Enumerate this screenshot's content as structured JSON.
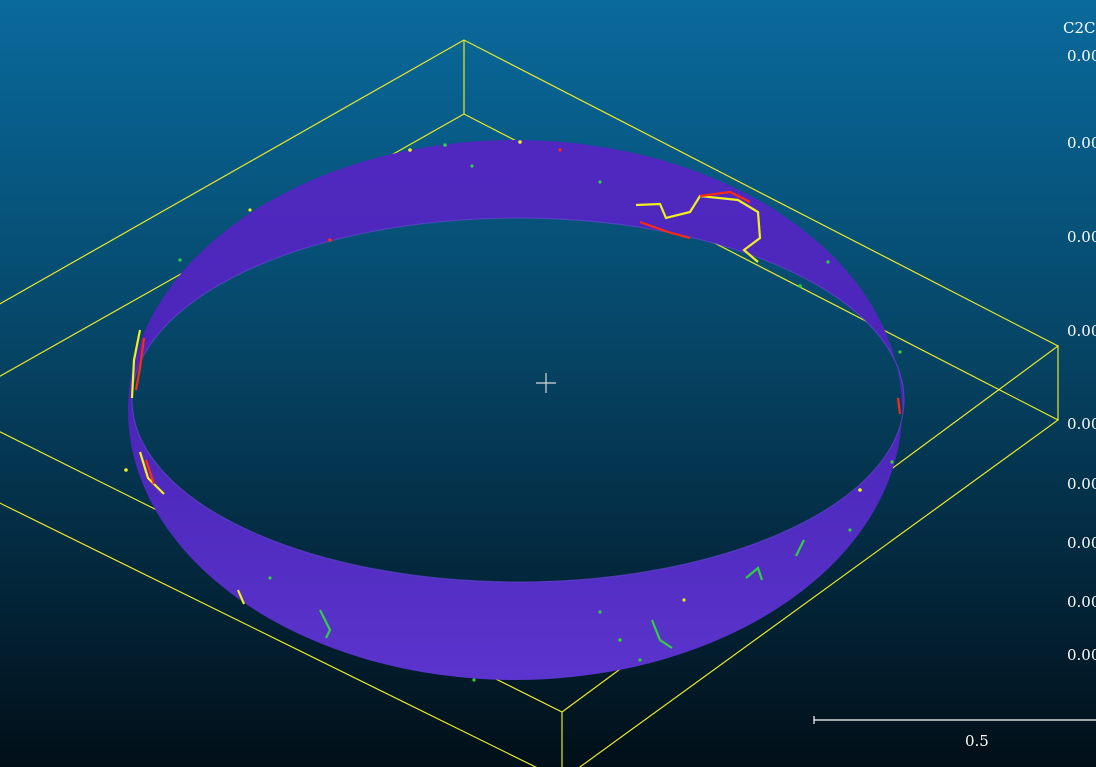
{
  "viewer": {
    "scalar_field_title": "C2C",
    "scale_ticks": [
      "0.00",
      "0.00",
      "0.00",
      "0.00",
      "0.00",
      "0.00",
      "0.00",
      "0.00",
      "0.00"
    ],
    "scale_bar_label": "0.5"
  },
  "colors": {
    "background_top": "#0a6a9c",
    "background_bottom": "#010f18",
    "bounding_box": "#e8e82a",
    "point_cloud": "#5530c8",
    "deviation_high": "#ff2a10",
    "deviation_mid": "#f0f020",
    "deviation_low": "#30d040"
  },
  "icons": {
    "pivot": "crosshair-icon"
  }
}
